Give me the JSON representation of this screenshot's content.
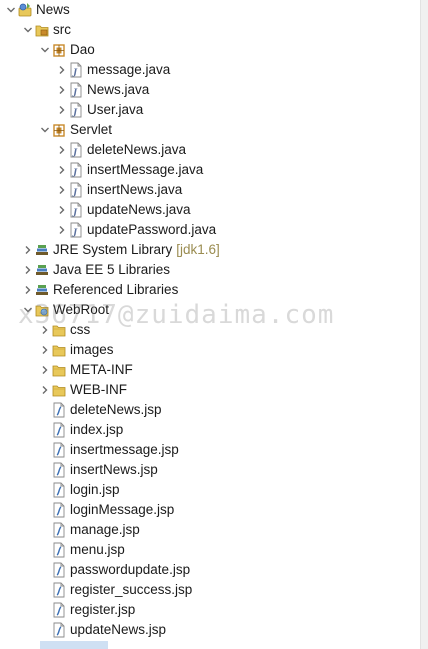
{
  "tree": [
    {
      "label": "News",
      "depth": 0,
      "expand": "open",
      "icon": "project-icon"
    },
    {
      "label": "src",
      "depth": 1,
      "expand": "open",
      "icon": "source-folder-icon"
    },
    {
      "label": "Dao",
      "depth": 2,
      "expand": "open",
      "icon": "package-icon"
    },
    {
      "label": "message.java",
      "depth": 3,
      "expand": "closed",
      "icon": "java-file-icon"
    },
    {
      "label": "News.java",
      "depth": 3,
      "expand": "closed",
      "icon": "java-file-icon"
    },
    {
      "label": "User.java",
      "depth": 3,
      "expand": "closed",
      "icon": "java-file-icon"
    },
    {
      "label": "Servlet",
      "depth": 2,
      "expand": "open",
      "icon": "package-icon"
    },
    {
      "label": "deleteNews.java",
      "depth": 3,
      "expand": "closed",
      "icon": "java-file-icon"
    },
    {
      "label": "insertMessage.java",
      "depth": 3,
      "expand": "closed",
      "icon": "java-file-icon"
    },
    {
      "label": "insertNews.java",
      "depth": 3,
      "expand": "closed",
      "icon": "java-file-icon"
    },
    {
      "label": "updateNews.java",
      "depth": 3,
      "expand": "closed",
      "icon": "java-file-icon"
    },
    {
      "label": "updatePassword.java",
      "depth": 3,
      "expand": "closed",
      "icon": "java-file-icon"
    },
    {
      "label": "JRE System Library",
      "suffix": "[jdk1.6]",
      "depth": 1,
      "expand": "closed",
      "icon": "library-icon"
    },
    {
      "label": "Java EE 5 Libraries",
      "depth": 1,
      "expand": "closed",
      "icon": "library-icon"
    },
    {
      "label": "Referenced Libraries",
      "depth": 1,
      "expand": "closed",
      "icon": "library-icon"
    },
    {
      "label": "WebRoot",
      "depth": 1,
      "expand": "open",
      "icon": "web-folder-icon"
    },
    {
      "label": "css",
      "depth": 2,
      "expand": "closed",
      "icon": "folder-icon"
    },
    {
      "label": "images",
      "depth": 2,
      "expand": "closed",
      "icon": "folder-icon"
    },
    {
      "label": "META-INF",
      "depth": 2,
      "expand": "closed",
      "icon": "folder-icon"
    },
    {
      "label": "WEB-INF",
      "depth": 2,
      "expand": "closed",
      "icon": "folder-icon"
    },
    {
      "label": "deleteNews.jsp",
      "depth": 2,
      "expand": "none",
      "icon": "jsp-file-icon"
    },
    {
      "label": "index.jsp",
      "depth": 2,
      "expand": "none",
      "icon": "jsp-file-icon"
    },
    {
      "label": "insertmessage.jsp",
      "depth": 2,
      "expand": "none",
      "icon": "jsp-file-icon"
    },
    {
      "label": "insertNews.jsp",
      "depth": 2,
      "expand": "none",
      "icon": "jsp-file-icon"
    },
    {
      "label": "login.jsp",
      "depth": 2,
      "expand": "none",
      "icon": "jsp-file-icon"
    },
    {
      "label": "loginMessage.jsp",
      "depth": 2,
      "expand": "none",
      "icon": "jsp-file-icon"
    },
    {
      "label": "manage.jsp",
      "depth": 2,
      "expand": "none",
      "icon": "jsp-file-icon"
    },
    {
      "label": "menu.jsp",
      "depth": 2,
      "expand": "none",
      "icon": "jsp-file-icon"
    },
    {
      "label": "passwordupdate.jsp",
      "depth": 2,
      "expand": "none",
      "icon": "jsp-file-icon"
    },
    {
      "label": "register_success.jsp",
      "depth": 2,
      "expand": "none",
      "icon": "jsp-file-icon"
    },
    {
      "label": "register.jsp",
      "depth": 2,
      "expand": "none",
      "icon": "jsp-file-icon"
    },
    {
      "label": "updateNews.jsp",
      "depth": 2,
      "expand": "none",
      "icon": "jsp-file-icon"
    }
  ],
  "watermark": "x36717@zuidaima.com",
  "colors": {
    "folder": "#e8c85a",
    "package": "#c98a2b",
    "java_file": "#5a6f9c",
    "library": "#7a6a3a",
    "arrow": "#6a6a6a",
    "selection": "#cfe0f3"
  }
}
